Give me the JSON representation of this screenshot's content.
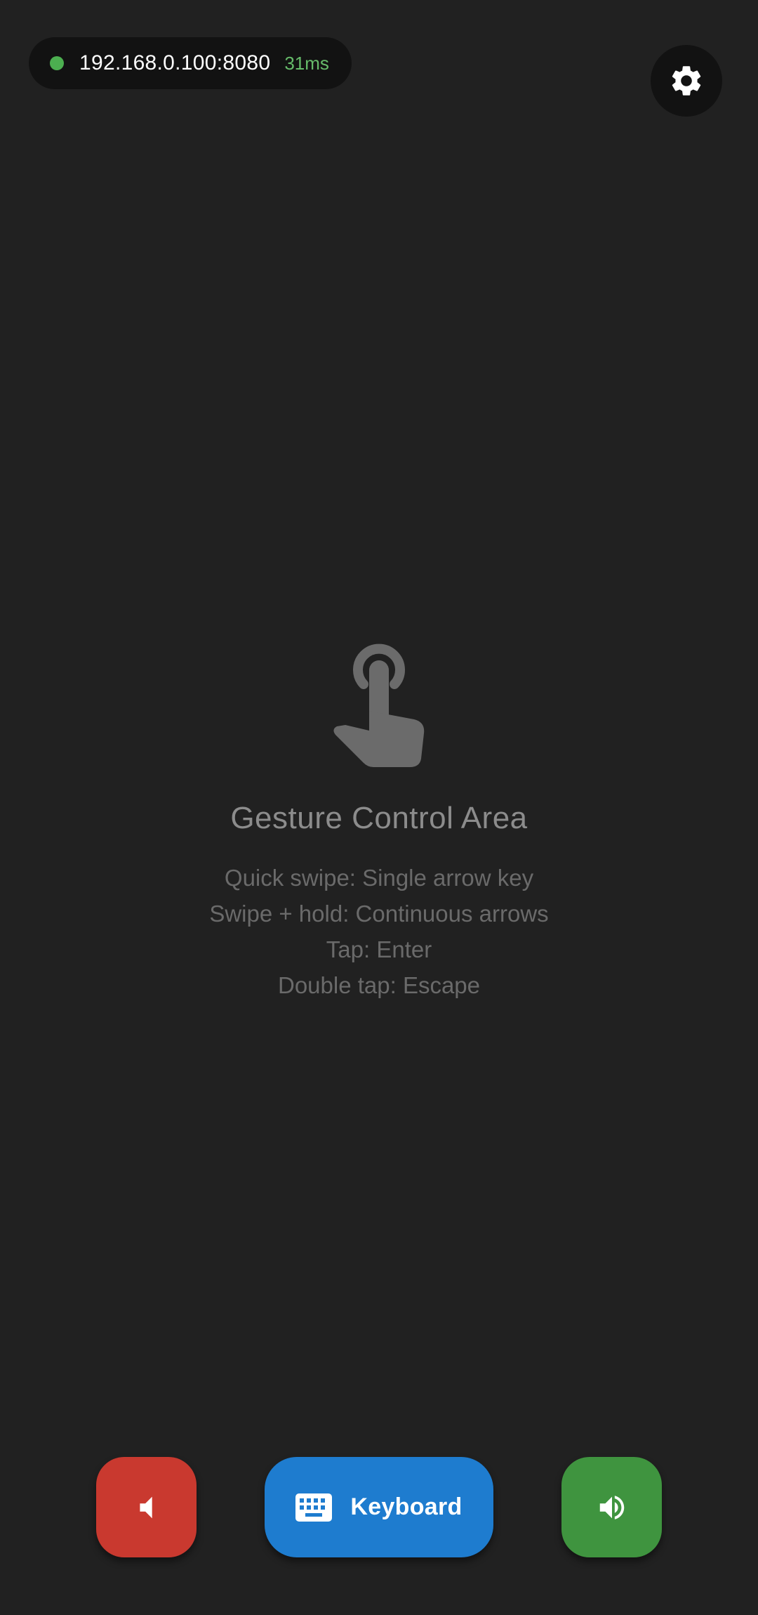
{
  "status": {
    "connection_color": "#4caf50",
    "address": "192.168.0.100:8080",
    "latency": "31ms"
  },
  "settings": {
    "icon": "gear-icon"
  },
  "gesture_area": {
    "icon": "touch-hand-icon",
    "title": "Gesture Control Area",
    "hints": [
      "Quick swipe: Single arrow key",
      "Swipe + hold: Continuous arrows",
      "Tap: Enter",
      "Double tap: Escape"
    ]
  },
  "controls": {
    "volume_down": {
      "icon": "volume-down-icon",
      "color": "#c9392f"
    },
    "keyboard": {
      "icon": "keyboard-icon",
      "label": "Keyboard",
      "color": "#1e7ccf"
    },
    "volume_up": {
      "icon": "volume-up-icon",
      "color": "#3f943f"
    }
  }
}
